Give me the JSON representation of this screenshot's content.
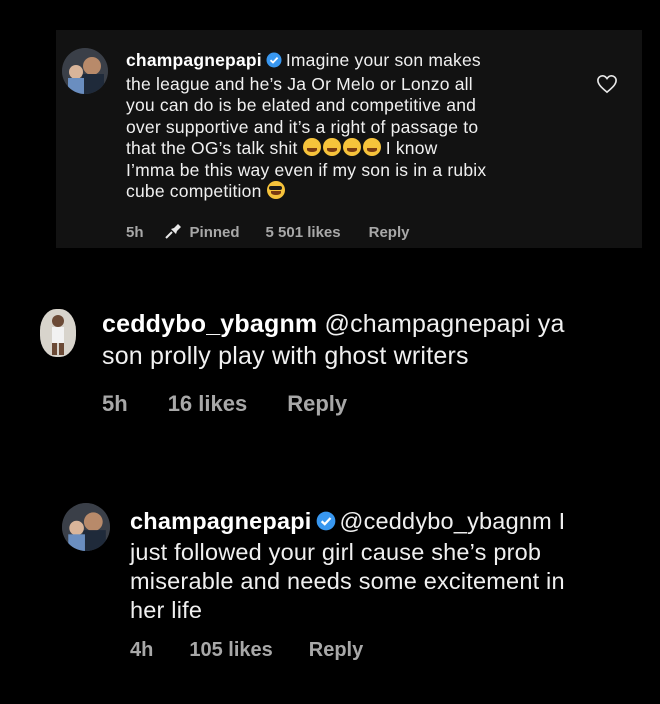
{
  "comments": [
    {
      "username": "champagnepapi",
      "verified": true,
      "lines": [
        "Imagine your son makes",
        "the league and he’s Ja Or Melo or Lonzo all",
        "you can do is be elated and competitive and",
        "over supportive and it’s a right of passage to",
        "that the OG’s talk shit",
        "I know",
        "I’mma be this way even if my son is in a rubix",
        "cube competition"
      ],
      "time": "5h",
      "pinned_label": "Pinned",
      "likes": "5 501 likes",
      "reply": "Reply",
      "emojis_after_line5": [
        "face-with-tears-of-joy-icon",
        "face-with-tears-of-joy-icon",
        "face-with-tears-of-joy-icon",
        "face-with-tears-of-joy-icon"
      ],
      "emoji_after_last_line": "smiling-face-with-sunglasses-icon"
    },
    {
      "username": "ceddybo_ybagnm",
      "verified": false,
      "lines": [
        "@champagnepapi ya",
        "son prolly play with ghost writers"
      ],
      "time": "5h",
      "likes": "16 likes",
      "reply": "Reply"
    },
    {
      "username": "champagnepapi",
      "verified": true,
      "lines": [
        "@ceddybo_ybagnm I",
        "just followed your girl cause she’s prob",
        "miserable and needs some excitement in",
        "her life"
      ],
      "time": "4h",
      "likes": "105 likes",
      "reply": "Reply"
    }
  ],
  "colors": {
    "background": "#000000",
    "pinned_card": "#121212",
    "text": "#f0f0f0",
    "meta": "#a8a8a8",
    "verified_badge": "#3897f0"
  }
}
